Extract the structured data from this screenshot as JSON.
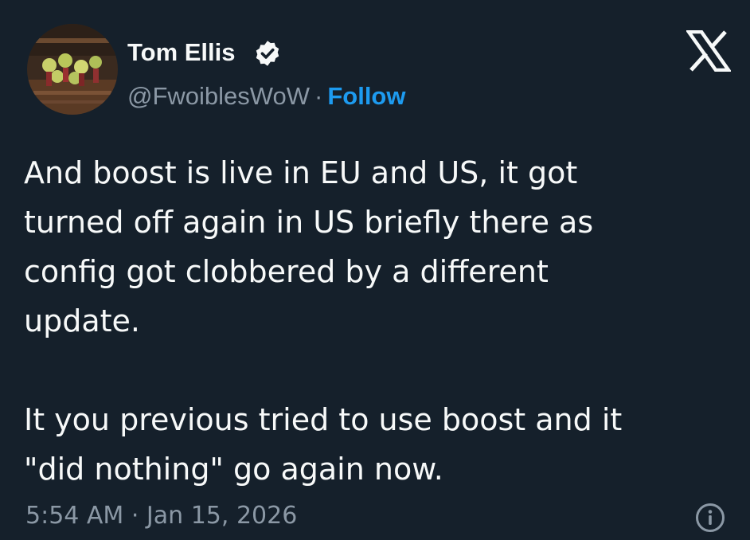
{
  "tweet": {
    "author_name": "Tom Ellis",
    "handle": "@FwoiblesWoW",
    "separator": "·",
    "follow_label": "Follow",
    "paragraphs": [
      "And boost is live in EU and US, it got\nturned off again in US briefly there as\nconfig got clobbered by a different\nupdate.",
      "It you previous tried to use boost and it\n\"did nothing\" go again now."
    ],
    "timestamp": "5:54 AM · Jan 15, 2026"
  },
  "icons": {
    "verified": "verified-badge-icon",
    "logo": "x-logo-icon",
    "info": "info-icon"
  },
  "colors": {
    "background": "#15202b",
    "text": "#f7f9f9",
    "muted": "#8b98a5",
    "accent": "#1d9bf0"
  }
}
